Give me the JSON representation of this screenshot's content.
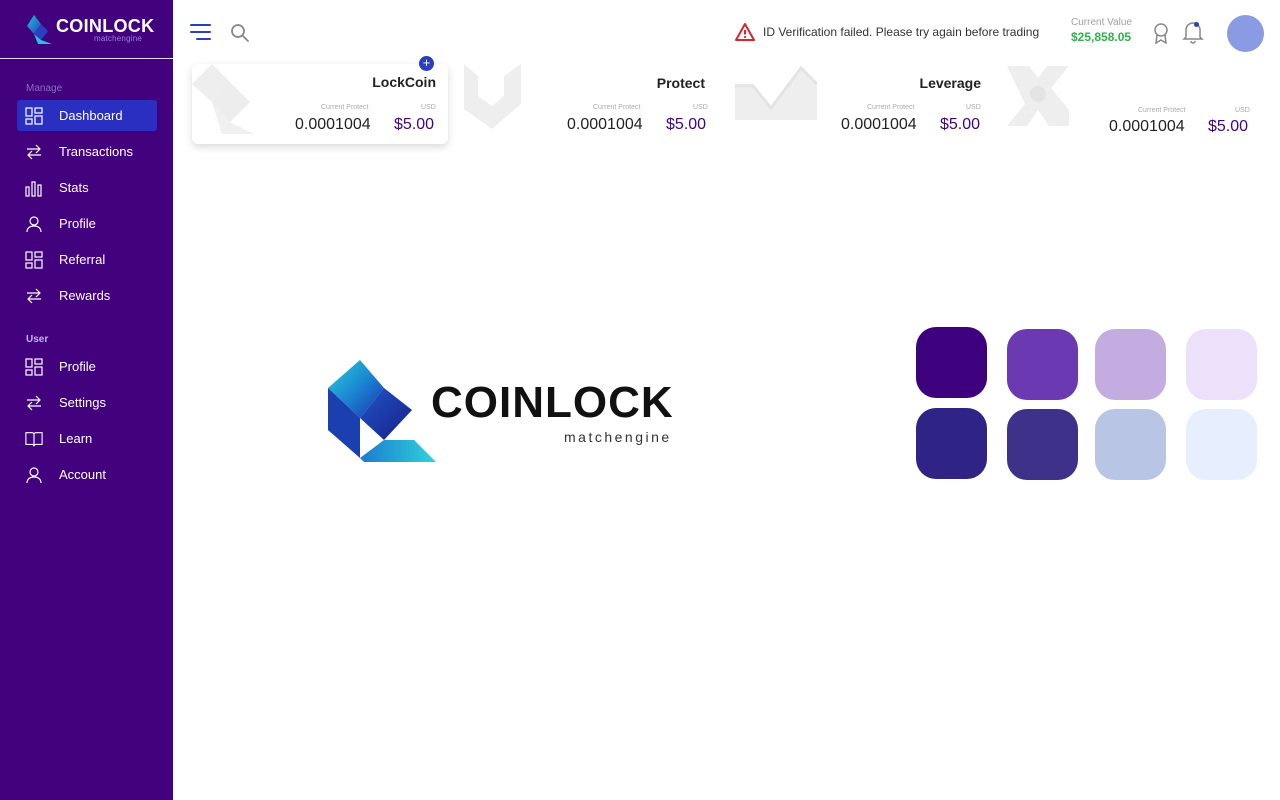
{
  "brand": {
    "name": "COINLOCK",
    "tagline": "matchengine"
  },
  "sidebar": {
    "sections": [
      {
        "label": "Manage"
      },
      {
        "label": "User"
      }
    ],
    "manage_items": [
      {
        "label": "Dashboard",
        "icon": "grid-icon",
        "active": true
      },
      {
        "label": "Transactions",
        "icon": "swap-arrows-icon"
      },
      {
        "label": "Stats",
        "icon": "bar-chart-icon"
      },
      {
        "label": "Profile",
        "icon": "user-icon"
      },
      {
        "label": "Referral",
        "icon": "grid-icon"
      },
      {
        "label": "Rewards",
        "icon": "swap-arrows-icon"
      }
    ],
    "user_items": [
      {
        "label": "Profile",
        "icon": "grid-icon"
      },
      {
        "label": "Settings",
        "icon": "swap-arrows-icon"
      },
      {
        "label": "Learn",
        "icon": "book-icon"
      },
      {
        "label": "Account",
        "icon": "user-icon"
      }
    ]
  },
  "topbar": {
    "alert_text": "ID Verification failed. Please try again before trading",
    "current_value_label": "Current Value",
    "current_value": "$25,858.05"
  },
  "cards": [
    {
      "name": "LockCoin",
      "label_left": "Current Protect",
      "label_right": "USD",
      "amount": "0.0001004",
      "usd": "$5.00"
    },
    {
      "name": "Protect",
      "label_left": "Current Protect",
      "label_right": "USD",
      "amount": "0.0001004",
      "usd": "$5.00"
    },
    {
      "name": "Leverage",
      "label_left": "Current Protect",
      "label_right": "USD",
      "amount": "0.0001004",
      "usd": "$5.00"
    },
    {
      "name": "",
      "label_left": "Current Protect",
      "label_right": "USD",
      "amount": "0.0001004",
      "usd": "$5.00"
    }
  ],
  "add_button": "+",
  "palette": {
    "row1": [
      "#3e017e",
      "#6b39b2",
      "#c3ade0",
      "#ece0fb"
    ],
    "row2": [
      "#2f2486",
      "#3d3189",
      "#b9c5e4",
      "#e7eefd"
    ]
  },
  "colors": {
    "sidebar_bg": "#42027e",
    "active_item": "#2a2fc2",
    "positive": "#2db34a",
    "usd": "#42027e"
  }
}
